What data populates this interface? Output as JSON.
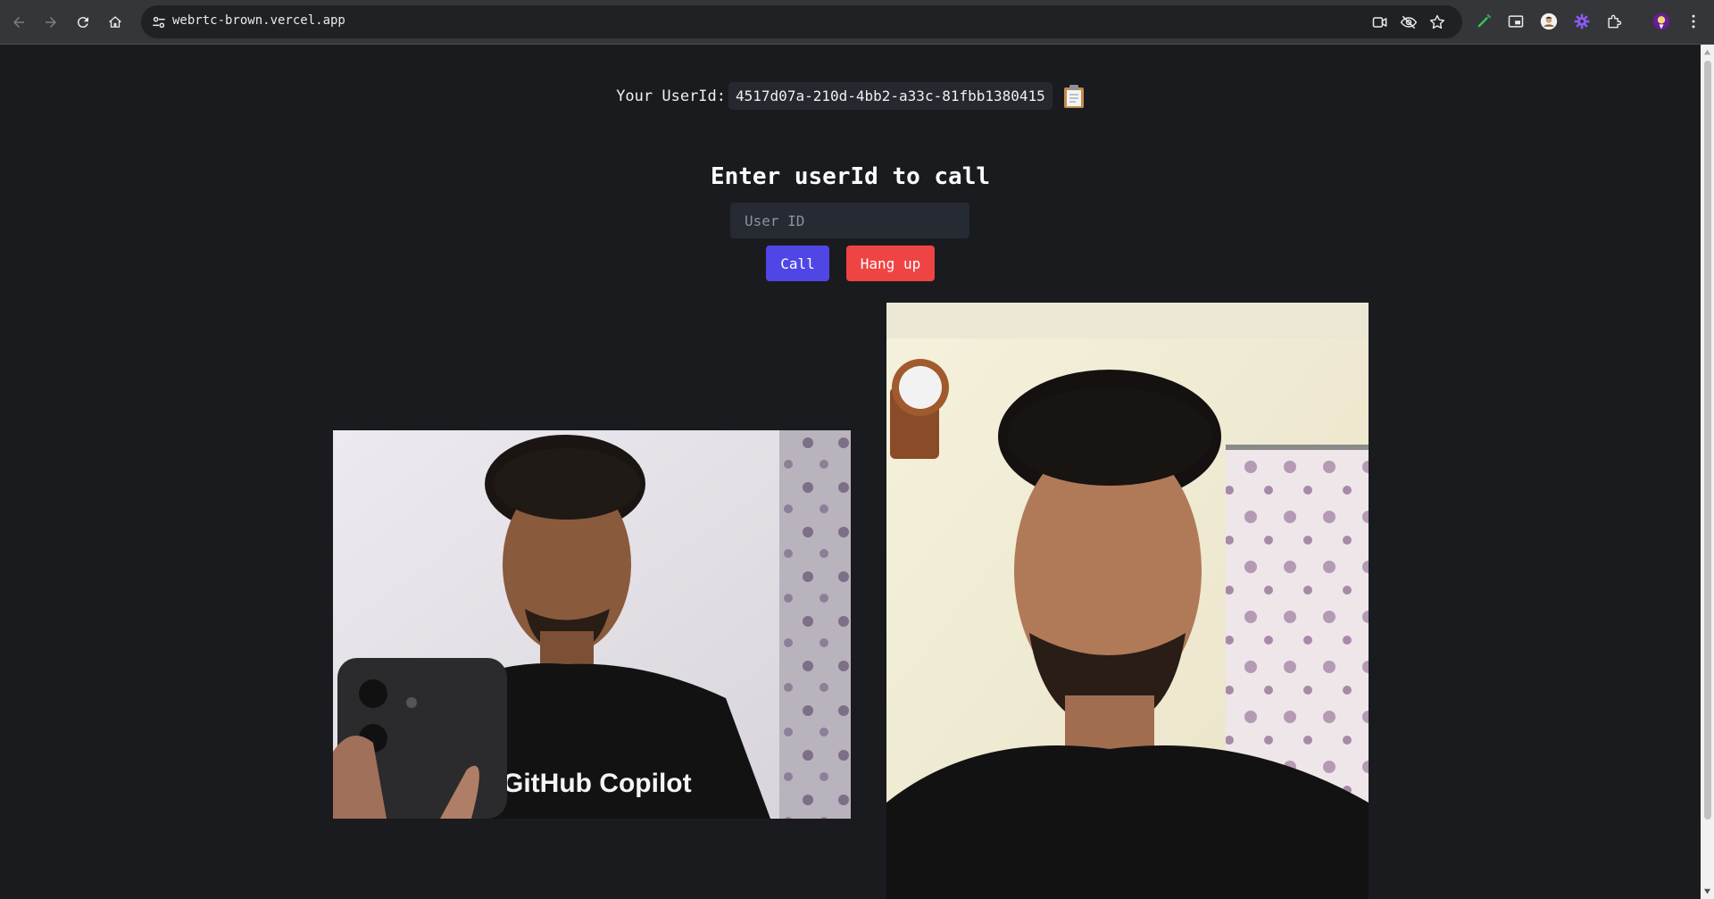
{
  "browser": {
    "url": "webrtc-brown.vercel.app",
    "icons": {
      "back": "arrow-left-icon",
      "forward": "arrow-right-icon",
      "reload": "reload-icon",
      "home": "home-icon",
      "site_info": "tune-icon",
      "camera": "camera-icon",
      "eye_off": "eye-off-icon",
      "bookmark": "star-icon",
      "extensions": [
        "pen-extension-icon",
        "picture-in-picture-icon",
        "avatar-extension-icon",
        "gear-extension-icon",
        "puzzle-icon",
        "profile-avatar-icon",
        "more-menu-icon"
      ]
    }
  },
  "page": {
    "userid_label": "Your UserId:",
    "userid_value": "4517d07a-210d-4bb2-a33c-81fbb1380415",
    "call_title": "Enter userId to call",
    "input_placeholder": "User ID",
    "input_value": "",
    "call_button": "Call",
    "hangup_button": "Hang up"
  },
  "colors": {
    "background": "#1a1b1e",
    "call_button": "#4f46e5",
    "hangup_button": "#ef4444",
    "input_bg": "#252a33"
  }
}
